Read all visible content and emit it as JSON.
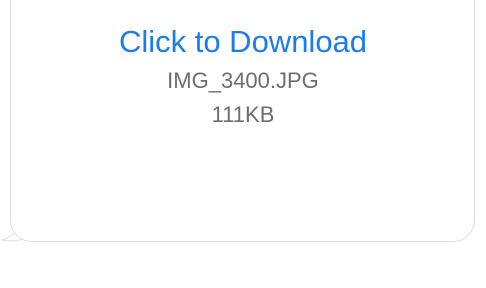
{
  "attachment": {
    "action_label": "Click to Download",
    "file_name": "IMG_3400.JPG",
    "file_size": "111KB"
  },
  "colors": {
    "link": "#1a7cf0",
    "meta_text": "#6e6e6e",
    "bubble_border": "#dedede"
  }
}
